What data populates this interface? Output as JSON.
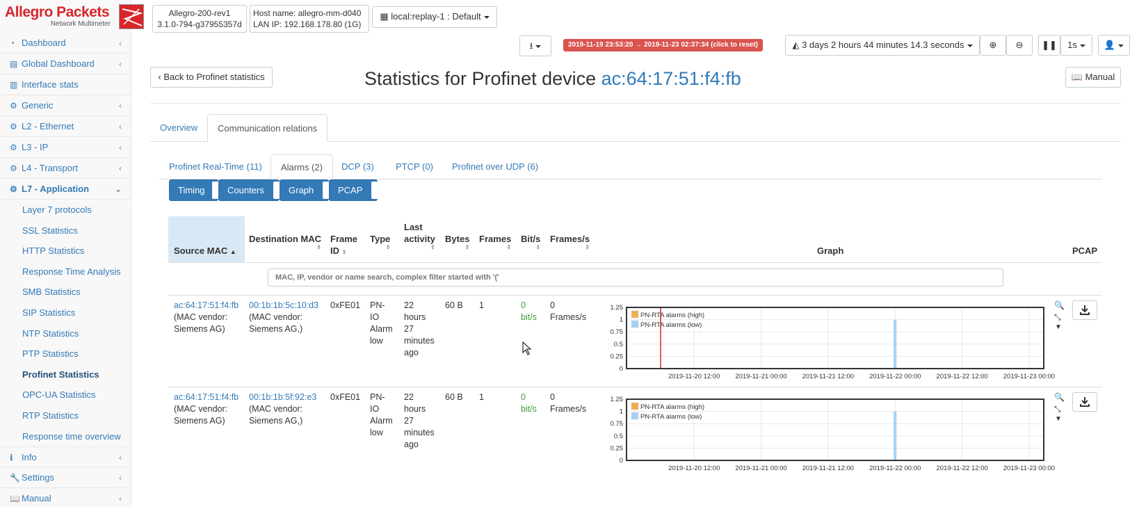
{
  "brand": {
    "name": "Allegro Packets",
    "tagline": "Network Multimeter"
  },
  "device_box": {
    "line1": "Allegro-200-rev1",
    "line2": "3.1.0-794-g37955357d"
  },
  "host_box": {
    "line1": "Host name: allegro-mm-d040",
    "line2": "LAN IP: 192.168.178.80 (1G)"
  },
  "replay_select": "local:replay-1 : Default",
  "time_range": "2019-11-19 23:53:20 → 2019-11-23 02:37:34  (click to reset)",
  "duration": "3 days 2 hours 44 minutes 14.3 seconds",
  "interval": "1s",
  "sidebar": {
    "items": [
      {
        "label": "Dashboard",
        "icon": "dashboard-icon"
      },
      {
        "label": "Global Dashboard",
        "icon": "global-dashboard-icon"
      },
      {
        "label": "Interface stats",
        "icon": "bar-chart-icon"
      },
      {
        "label": "Generic",
        "icon": "gear-icon"
      },
      {
        "label": "L2 - Ethernet",
        "icon": "gear-icon"
      },
      {
        "label": "L3 - IP",
        "icon": "gear-icon"
      },
      {
        "label": "L4 - Transport",
        "icon": "gear-icon"
      },
      {
        "label": "L7 - Application",
        "icon": "gear-icon"
      }
    ],
    "sub_items": [
      "Layer 7 protocols",
      "SSL Statistics",
      "HTTP Statistics",
      "Response Time Analysis",
      "SMB Statistics",
      "SIP Statistics",
      "NTP Statistics",
      "PTP Statistics",
      "Profinet Statistics",
      "OPC-UA Statistics",
      "RTP Statistics",
      "Response time overview"
    ],
    "bottom_items": [
      {
        "label": "Info",
        "icon": "info-icon"
      },
      {
        "label": "Settings",
        "icon": "wrench-icon"
      },
      {
        "label": "Manual",
        "icon": "book-icon"
      }
    ]
  },
  "main": {
    "back_button": "Back to Profinet statistics",
    "title_prefix": "Statistics for Profinet device",
    "title_mac": "ac:64:17:51:f4:fb",
    "manual_button": "Manual",
    "tabs": [
      "Overview",
      "Communication relations"
    ],
    "subtabs": [
      "Profinet Real-Time (11)",
      "Alarms (2)",
      "DCP (3)",
      "PTCP (0)",
      "Profinet over UDP (6)"
    ],
    "column_toggles": [
      "Timing",
      "Counters",
      "Graph",
      "PCAP"
    ],
    "columns": {
      "source_mac": "Source MAC",
      "destination_mac": "Destination MAC",
      "frame_id": [
        "Frame",
        "ID"
      ],
      "type": "Type",
      "last_activity": [
        "Last",
        "activity"
      ],
      "bytes": "Bytes",
      "frames": "Frames",
      "bits": "Bit/s",
      "frames_s": "Frames/s",
      "graph": "Graph",
      "pcap": "PCAP"
    },
    "search_placeholder": "MAC, IP, vendor or name search, complex filter started with '('",
    "rows": [
      {
        "source_mac": "ac:64:17:51:f4:fb",
        "source_vendor": [
          "(MAC vendor:",
          "Siemens AG)"
        ],
        "dest_mac": "00:1b:1b:5c:10:d3",
        "dest_vendor": [
          "(MAC vendor:",
          "Siemens AG,)"
        ],
        "frame_id": "0xFE01",
        "type": [
          "PN-",
          "IO",
          "Alarm",
          "low"
        ],
        "last_activity": [
          "22",
          "hours",
          "27",
          "minutes",
          "ago"
        ],
        "bytes": "60 B",
        "frames": "1",
        "bits": [
          "0",
          "bit/s"
        ],
        "frames_s": [
          "0",
          "Frames/s"
        ]
      },
      {
        "source_mac": "ac:64:17:51:f4:fb",
        "source_vendor": [
          "(MAC vendor:",
          "Siemens AG)"
        ],
        "dest_mac": "00:1b:1b:5f:92:e3",
        "dest_vendor": [
          "(MAC vendor:",
          "Siemens AG,)"
        ],
        "frame_id": "0xFE01",
        "type": [
          "PN-",
          "IO",
          "Alarm",
          "low"
        ],
        "last_activity": [
          "22",
          "hours",
          "27",
          "minutes",
          "ago"
        ],
        "bytes": "60 B",
        "frames": "1",
        "bits": [
          "0",
          "bit/s"
        ],
        "frames_s": [
          "0",
          "Frames/s"
        ]
      }
    ]
  },
  "colors": {
    "accent": "#337ab7",
    "danger": "#d9534f",
    "alarm_high": "#f0ad4e",
    "alarm_low": "#a6d1f5",
    "marker": "#d9262b"
  },
  "chart_data": [
    {
      "type": "bar",
      "ylim": [
        0,
        1.25
      ],
      "yticks": [
        "1.25",
        "1",
        "0.75",
        "0.5",
        "0.25",
        "0"
      ],
      "xticks": [
        "2019-11-20 12:00",
        "2019-11-21 00:00",
        "2019-11-21 12:00",
        "2019-11-22 00:00",
        "2019-11-22 12:00",
        "2019-11-23 00:00"
      ],
      "legend_position": "top-left",
      "series": [
        {
          "name": "PN-RTA alarms (high)",
          "color": "#f0ad4e",
          "points": []
        },
        {
          "name": "PN-RTA alarms (low)",
          "color": "#a6d1f5",
          "points": [
            {
              "x": "2019-11-22 00:00",
              "y": 1
            }
          ]
        }
      ],
      "marker_x": "2019-11-20 06:00"
    },
    {
      "type": "bar",
      "ylim": [
        0,
        1.25
      ],
      "yticks": [
        "1.25",
        "1",
        "0.75",
        "0.5",
        "0.25",
        "0"
      ],
      "xticks": [
        "2019-11-20 12:00",
        "2019-11-21 00:00",
        "2019-11-21 12:00",
        "2019-11-22 00:00",
        "2019-11-22 12:00",
        "2019-11-23 00:00"
      ],
      "legend_position": "top-left",
      "series": [
        {
          "name": "PN-RTA alarms (high)",
          "color": "#f0ad4e",
          "points": []
        },
        {
          "name": "PN-RTA alarms (low)",
          "color": "#a6d1f5",
          "points": [
            {
              "x": "2019-11-22 00:00",
              "y": 1
            }
          ]
        }
      ]
    }
  ]
}
